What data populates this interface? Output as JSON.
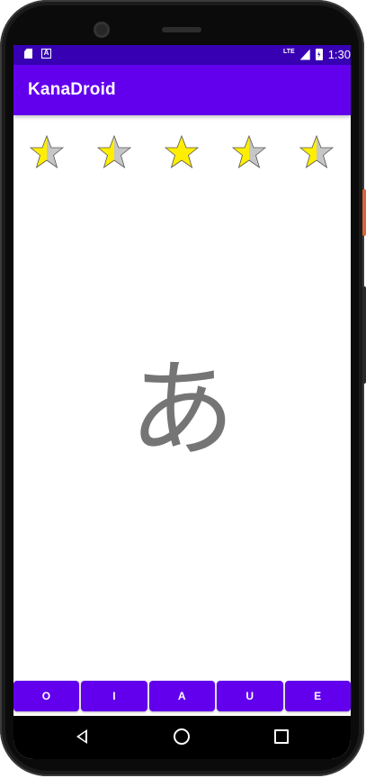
{
  "status_bar": {
    "time": "1:30",
    "network": "LTE",
    "icons": [
      "sd-card-icon",
      "a-notification-icon",
      "signal-icon",
      "battery-charging-icon"
    ]
  },
  "app_bar": {
    "title": "KanaDroid",
    "color": "#6200ee"
  },
  "rating": {
    "stars": [
      {
        "fill": 0.5
      },
      {
        "fill": 0.5
      },
      {
        "fill": 1.0
      },
      {
        "fill": 0.5
      },
      {
        "fill": 0.5
      }
    ],
    "filled_color": "#ffee00",
    "empty_color": "#c6c6c6"
  },
  "quiz": {
    "kana": "あ"
  },
  "answers": [
    "O",
    "I",
    "A",
    "U",
    "E"
  ]
}
